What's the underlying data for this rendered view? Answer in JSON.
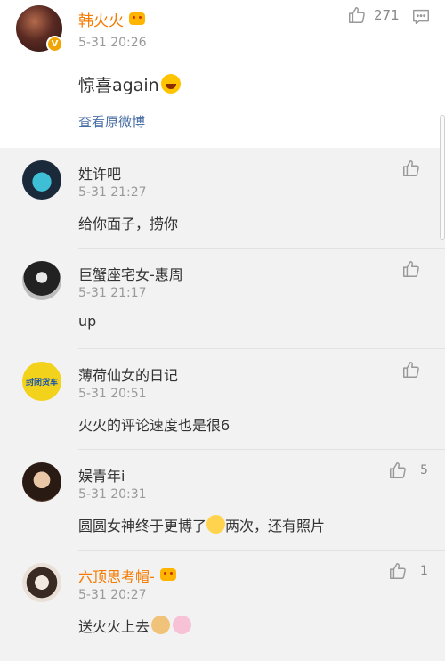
{
  "post": {
    "author": "韩火火",
    "time": "5-31 20:26",
    "text": "惊喜again",
    "link": "查看原微博",
    "likes": "271",
    "badge": "V",
    "colors": {
      "name": "#f47a00",
      "link": "#4a6fa5"
    }
  },
  "comments": [
    {
      "name": "姓许吧",
      "time": "5-31 21:27",
      "text": "给你面子，捞你",
      "likes": ""
    },
    {
      "name": "巨蟹座宅女-惠周",
      "time": "5-31 21:17",
      "text": "up",
      "likes": ""
    },
    {
      "name": "薄荷仙女的日记",
      "time": "5-31 20:51",
      "text": "火火的评论速度也是很6",
      "likes": "",
      "avatar_text": "封闭货车"
    },
    {
      "name": "娱青年i",
      "time": "5-31 20:31",
      "text": "圆圆女神终于更博了",
      "text_after": "两次，还有照片",
      "likes": "5"
    },
    {
      "name": "六顶思考帽-",
      "time": "5-31 20:27",
      "text": "送火火上去",
      "likes": "1"
    }
  ]
}
